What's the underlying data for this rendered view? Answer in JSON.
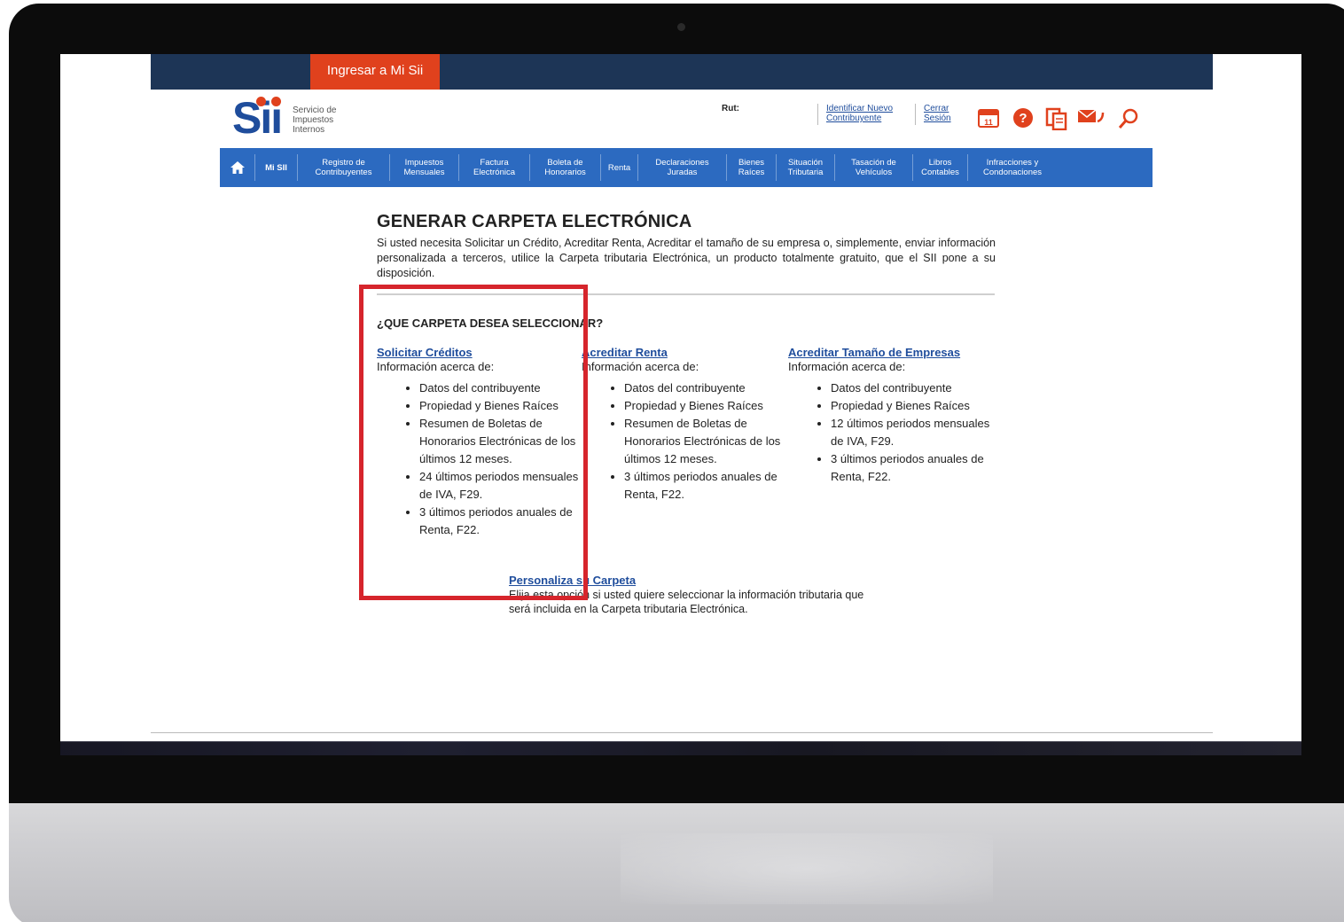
{
  "topbar": {
    "login_label": "Ingresar a Mi Sii"
  },
  "logo": {
    "letters": "Sii",
    "text": "Servicio de Impuestos Internos"
  },
  "header": {
    "rut_label": "Rut:",
    "identify_link": "Identificar Nuevo Contribuyente",
    "logout_link": "Cerrar Sesión",
    "icons": [
      "calendar-icon",
      "help-icon",
      "documents-icon",
      "mail-icon",
      "search-icon"
    ],
    "calendar_day": "11"
  },
  "nav": {
    "items": [
      "Mi SII",
      "Registro de Contribuyentes",
      "Impuestos Mensuales",
      "Factura Electrónica",
      "Boleta de Honorarios",
      "Renta",
      "Declaraciones Juradas",
      "Bienes Raíces",
      "Situación Tributaria",
      "Tasación de Vehículos",
      "Libros Contables",
      "Infracciones y Condonaciones"
    ]
  },
  "main": {
    "title": "GENERAR CARPETA ELECTRÓNICA",
    "intro": "Si usted necesita Solicitar un Crédito, Acreditar Renta, Acreditar el tamaño de su empresa o, simplemente, enviar información personalizada a terceros, utilice la Carpeta tributaria Electrónica, un producto totalmente gratuito, que el SII pone a su disposición.",
    "question": "¿QUE CARPETA DESEA SELECCIONAR?",
    "columns": [
      {
        "link": "Solicitar Créditos",
        "sub": "Información acerca de:",
        "items": [
          "Datos del contribuyente",
          "Propiedad y Bienes Raíces",
          "Resumen de Boletas de Honorarios Electrónicas de los últimos 12 meses.",
          "24 últimos periodos mensuales de IVA, F29.",
          "3 últimos periodos anuales de Renta, F22."
        ]
      },
      {
        "link": "Acreditar Renta",
        "sub": "Información acerca de:",
        "items": [
          "Datos del contribuyente",
          "Propiedad y Bienes Raíces",
          "Resumen de Boletas de Honorarios Electrónicas de los últimos 12 meses.",
          "3 últimos periodos anuales de Renta, F22."
        ]
      },
      {
        "link": "Acreditar Tamaño de Empresas",
        "sub": "Información acerca de:",
        "items": [
          "Datos del contribuyente",
          "Propiedad y Bienes Raíces",
          "12 últimos periodos mensuales de IVA, F29.",
          "3 últimos periodos anuales de Renta, F22."
        ]
      }
    ],
    "personalize": {
      "link": "Personaliza su Carpeta",
      "text": "Elija esta opción si usted quiere seleccionar la información tributaria que será incluida en la Carpeta tributaria Electrónica."
    }
  },
  "colors": {
    "navy": "#1d3556",
    "orange": "#e0411d",
    "nav_blue": "#2c6ac0",
    "link_blue": "#1f4d9c",
    "highlight_red": "#d6252c"
  }
}
